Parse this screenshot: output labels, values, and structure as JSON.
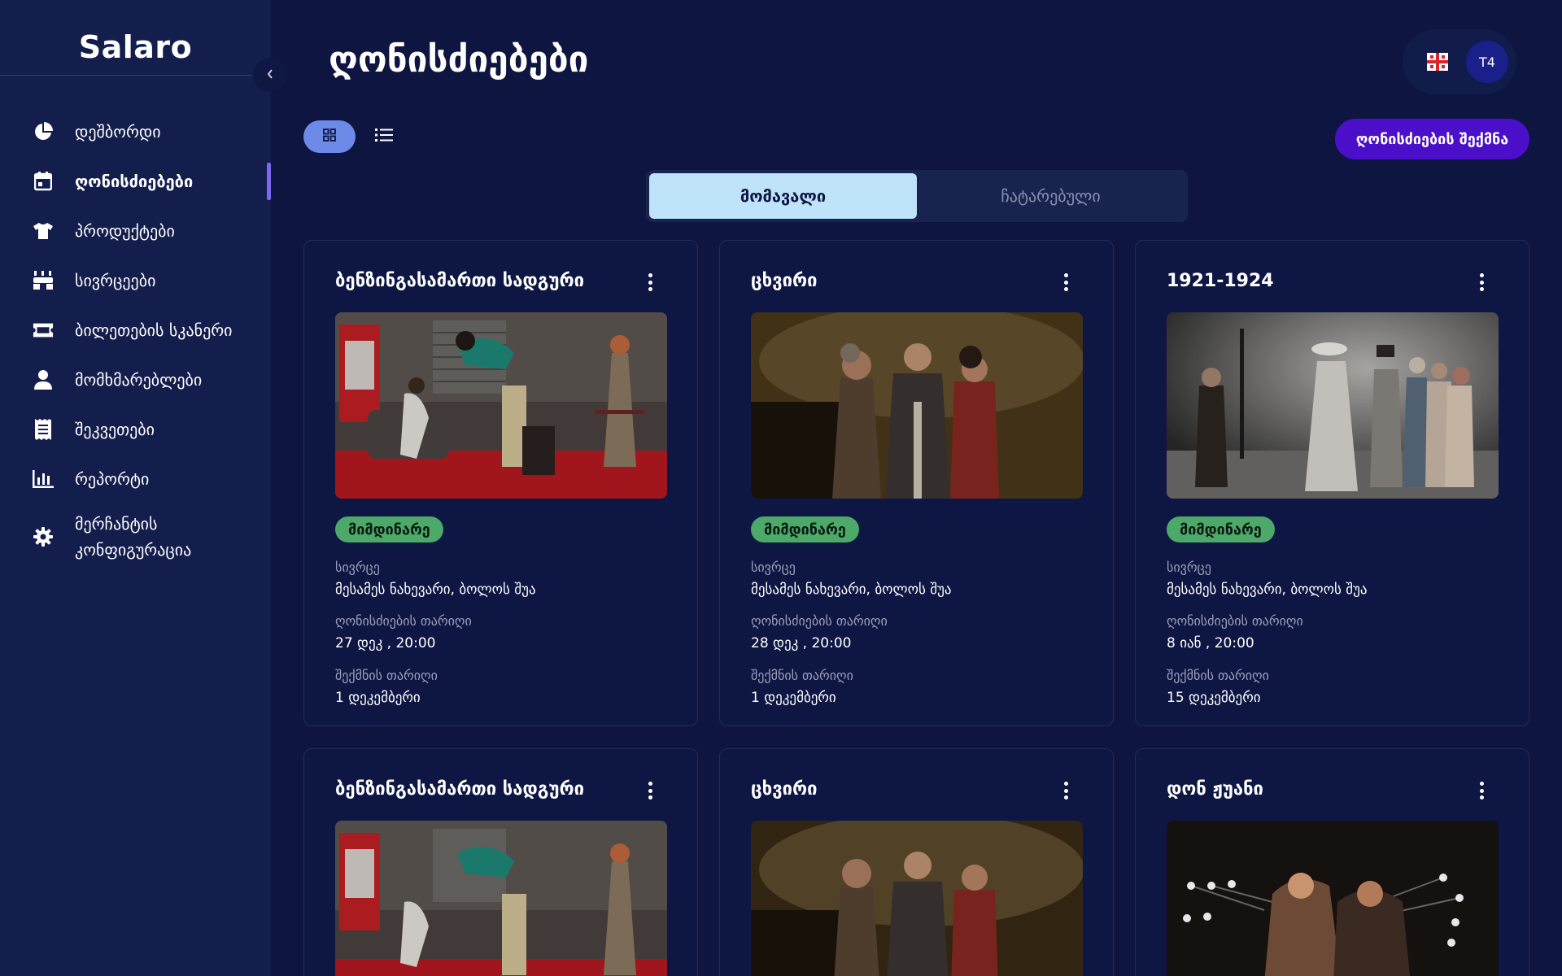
{
  "sidebar": {
    "brand": "Salaro",
    "items": [
      {
        "label": "დეშბორდი",
        "icon": "pie-chart-icon"
      },
      {
        "label": "ღონისძიებები",
        "icon": "calendar-icon",
        "active": true
      },
      {
        "label": "პროდუქტები",
        "icon": "tshirt-icon"
      },
      {
        "label": "სივრცეები",
        "icon": "seats-icon"
      },
      {
        "label": "ბილეთების სკანერი",
        "icon": "ticket-icon"
      },
      {
        "label": "მომხმარებლები",
        "icon": "user-icon"
      },
      {
        "label": "შეკვეთები",
        "icon": "receipt-icon"
      },
      {
        "label": "რეპორტი",
        "icon": "bar-chart-icon"
      },
      {
        "label_line1": "მერჩანტის",
        "label_line2": "კონფიგურაცია",
        "icon": "gear-icon"
      }
    ]
  },
  "header": {
    "title": "ღონისძიებები",
    "avatar": "T4",
    "language_flag": "georgia-flag-icon",
    "create_button": "ღონისძიების შექმნა"
  },
  "tabs": [
    "მომავალი",
    "ჩატარებული"
  ],
  "labels": {
    "venue": "სივრცე",
    "event_date": "ღონისძიების თარიღი",
    "created_date": "შექმნის თარიღი"
  },
  "cards": [
    {
      "title": "ბენზინგასამართი სადგური",
      "status": "მიმდინარე",
      "venue": "მესამეს ნახევარი, ბოლოს შუა",
      "event_date": "27 დეკ , 20:00",
      "created": "1 დეკემბერი"
    },
    {
      "title": "ცხვირი",
      "status": "მიმდინარე",
      "venue": "მესამეს ნახევარი, ბოლოს შუა",
      "event_date": "28 დეკ , 20:00",
      "created": "1 დეკემბერი"
    },
    {
      "title": "1921-1924",
      "status": "მიმდინარე",
      "venue": "მესამეს ნახევარი, ბოლოს შუა",
      "event_date": "8 იან , 20:00",
      "created": "15 დეკემბერი"
    },
    {
      "title": "ბენზინგასამართი სადგური"
    },
    {
      "title": "ცხვირი"
    },
    {
      "title": "დონ ჟუანი"
    }
  ],
  "colors": {
    "background": "#0d1540",
    "sidebar": "#141e4d",
    "accent": "#4b0fc9",
    "active_tab": "#bfe4fa",
    "status_badge": "#4ca96a"
  }
}
